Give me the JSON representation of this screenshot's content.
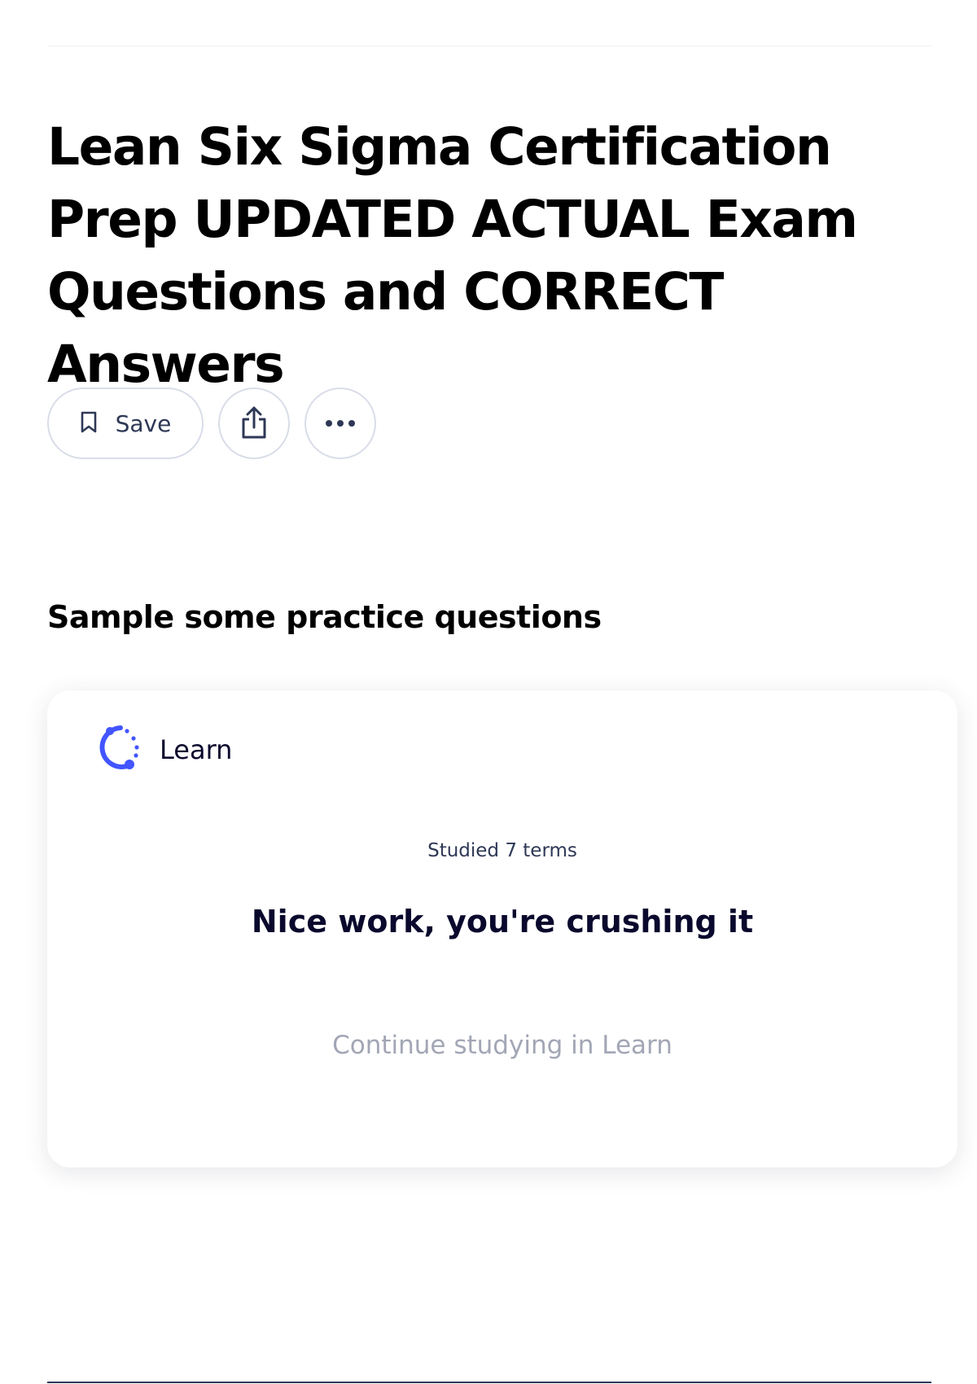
{
  "page": {
    "title": "Lean Six Sigma Certification Prep UPDATED ACTUAL Exam Questions and CORRECT Answers"
  },
  "actions": {
    "save_label": "Save",
    "save_icon": "bookmark-icon",
    "share_icon": "share-icon",
    "more_icon": "more-icon"
  },
  "practice": {
    "heading": "Sample some practice questions",
    "card": {
      "mode_icon": "learn-icon",
      "mode_label": "Learn",
      "studied_text": "Studied 7 terms",
      "message": "Nice work, you're crushing it",
      "continue_label": "Continue studying in Learn"
    }
  },
  "colors": {
    "text_primary": "#0a092d",
    "text_secondary": "#2e3856",
    "muted": "#a2a6b5",
    "accent": "#4255ff",
    "border": "#d9dde8"
  }
}
